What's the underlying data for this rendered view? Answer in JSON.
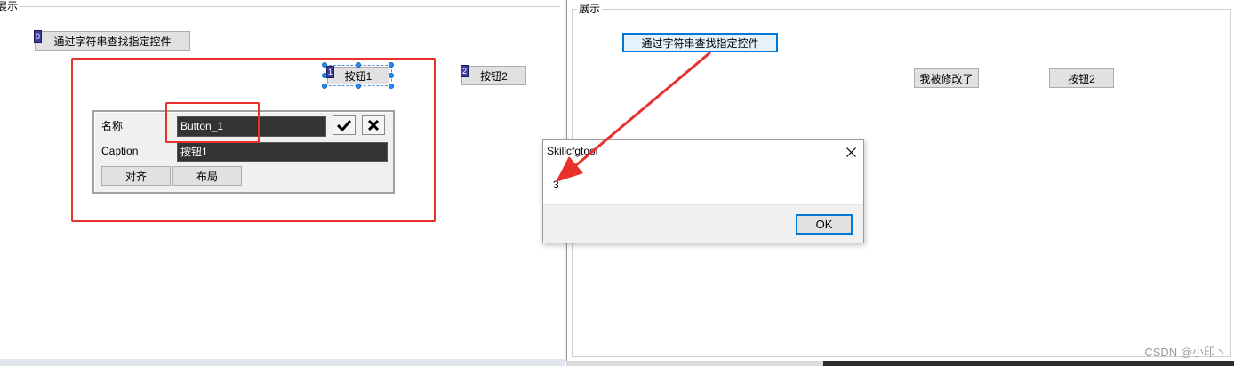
{
  "left_pane": {
    "group_title": "展示",
    "find_button_label": "通过字符串查找指定控件",
    "find_button_tag": "0",
    "button1_label": "按钮1",
    "button1_tag": "1",
    "button2_label": "按钮2",
    "button2_tag": "2"
  },
  "property_panel": {
    "name_label": "名称",
    "name_value": "Button_1",
    "caption_label": "Caption",
    "caption_value": "按钮1",
    "confirm_icon": "check-icon",
    "cancel_icon": "close-icon",
    "align_button": "对齐",
    "layout_button": "布局"
  },
  "right_pane": {
    "group_title": "展示",
    "find_button_label": "通过字符串查找指定控件",
    "modified_button_label": "我被修改了",
    "button2_label": "按钮2"
  },
  "message_box": {
    "title": "Skillcfgtool",
    "close_icon": "close-icon",
    "message": "3",
    "ok_label": "OK"
  },
  "watermark": "CSDN @小印丶",
  "colors": {
    "annotation_red": "#e8312a",
    "selection_blue": "#1f8cff",
    "focus_blue": "#0078d7",
    "input_dark": "#333333"
  }
}
